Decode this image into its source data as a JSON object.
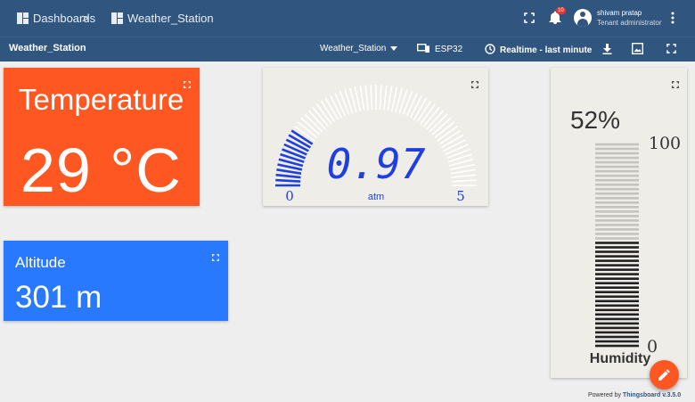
{
  "topbar": {
    "breadcrumb_root": "Dashboards",
    "breadcrumb_separator": ">",
    "breadcrumb_current": "Weather_Station",
    "notifications_count": "10",
    "user_name": "shivam pratap",
    "user_role": "Tenant administrator"
  },
  "toolbar": {
    "dashboard_title": "Weather_Station",
    "state_select": "Weather_Station",
    "entity_alias": "ESP32",
    "timewindow": "Realtime - last minute"
  },
  "widgets": {
    "temperature": {
      "title": "Temperature",
      "value": "29 °C",
      "color": "#ff5722"
    },
    "altitude": {
      "title": "Altitude",
      "value": "301 m",
      "color": "#2979ff"
    },
    "pressure_gauge": {
      "value": 0.97,
      "value_text": "0.97",
      "min_label": "0",
      "max_label": "5",
      "min": 0,
      "max": 5,
      "units": "atm",
      "color": "#1f3fe0"
    },
    "humidity": {
      "value_text": "52%",
      "value": 52,
      "max_label": "100",
      "min_label": "0",
      "min": 0,
      "max": 100,
      "label": "Humidity",
      "color": "#222222"
    }
  },
  "footer": {
    "powered_prefix": "Powered by",
    "powered_brand": "Thingsboard v.3.5.0"
  },
  "colors": {
    "header": "#305680",
    "background": "#eeeeee",
    "fab": "#ff5722"
  }
}
